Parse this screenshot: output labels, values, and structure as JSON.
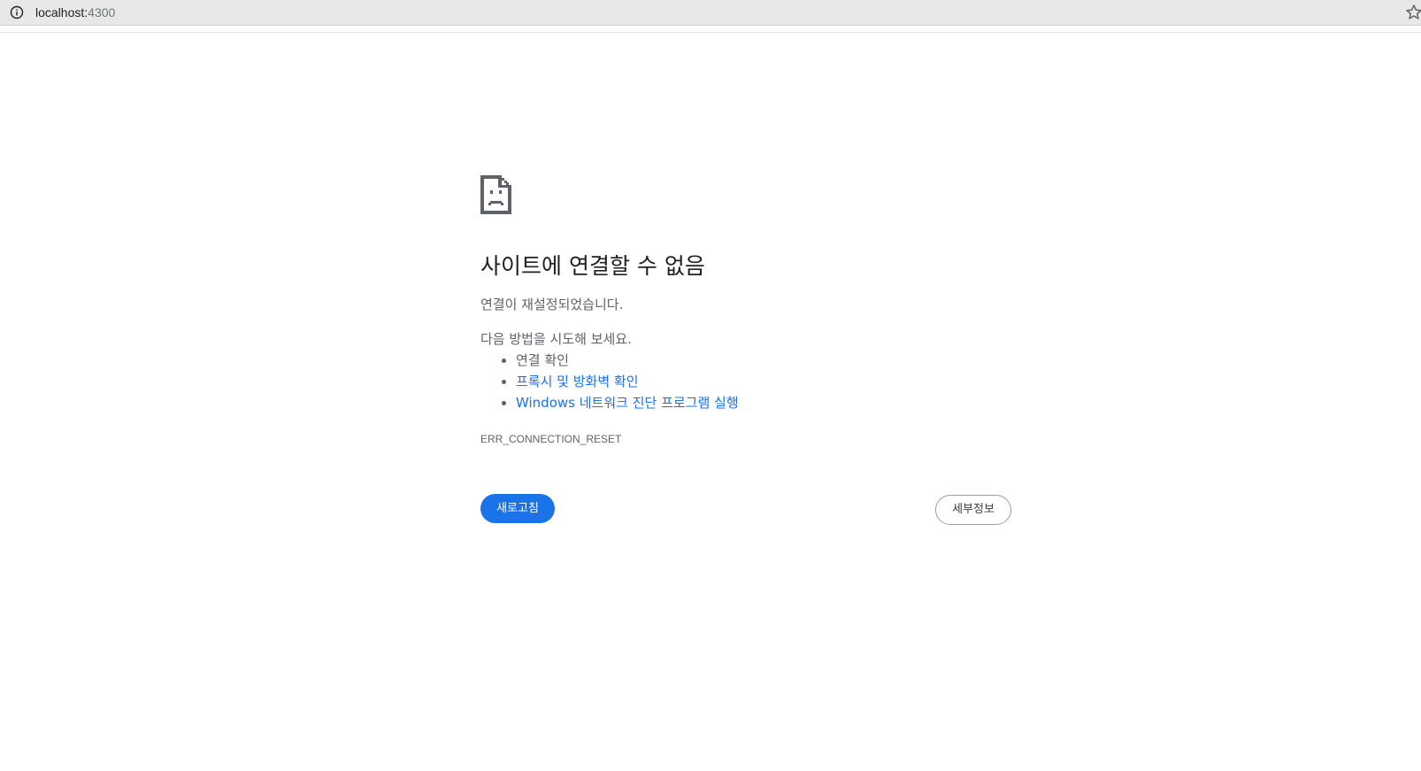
{
  "browser": {
    "url_host": "localhost:",
    "url_port": "4300",
    "info_icon": "info-icon",
    "bookmark_icon": "star-icon"
  },
  "error": {
    "icon": "sad-page-icon",
    "title": "사이트에 연결할 수 없음",
    "message": "연결이 재설정되었습니다.",
    "suggest_heading": "다음 방법을 시도해 보세요.",
    "suggestions": [
      {
        "label": "연결 확인",
        "is_link": false
      },
      {
        "label": "프록시 및 방화벽 확인",
        "is_link": true
      },
      {
        "label": "Windows 네트워크 진단 프로그램 실행",
        "is_link": true
      }
    ],
    "code": "ERR_CONNECTION_RESET"
  },
  "buttons": {
    "reload_label": "새로고침",
    "details_label": "세부정보"
  },
  "colors": {
    "link": "#1a73e8",
    "primary_button": "#1a73e8",
    "text": "#5f6368",
    "address_bar": "#e8e8e8"
  }
}
